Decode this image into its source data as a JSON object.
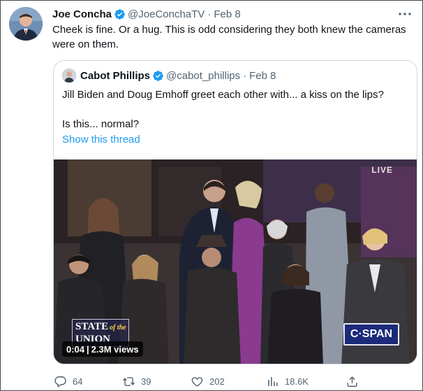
{
  "tweet": {
    "author_name": "Joe Concha",
    "handle": "@JoeConchaTV",
    "date": "Feb 8",
    "text": "Cheek is fine. Or a hug. This is odd considering they both knew the cameras were on them."
  },
  "quoted_tweet": {
    "author_name": "Cabot Phillips",
    "handle": "@cabot_phillips",
    "date": "Feb 8",
    "text_line1": "Jill Biden and Doug Emhoff greet each other with... a kiss on the lips?",
    "text_line2": "Is this... normal?",
    "show_thread": "Show this thread",
    "video": {
      "live_label": "LIVE",
      "logo_line1": "STATE",
      "logo_of": "of the",
      "logo_line2": "UNION",
      "duration": "0:04",
      "views": "2.3M views",
      "network": "C·SPAN"
    }
  },
  "actions": {
    "replies": "64",
    "retweets": "39",
    "likes": "202",
    "views": "18.6K"
  },
  "colors": {
    "link": "#1d9bf0",
    "verified": "#1d9bf0",
    "muted": "#536471",
    "text": "#0f1419"
  }
}
